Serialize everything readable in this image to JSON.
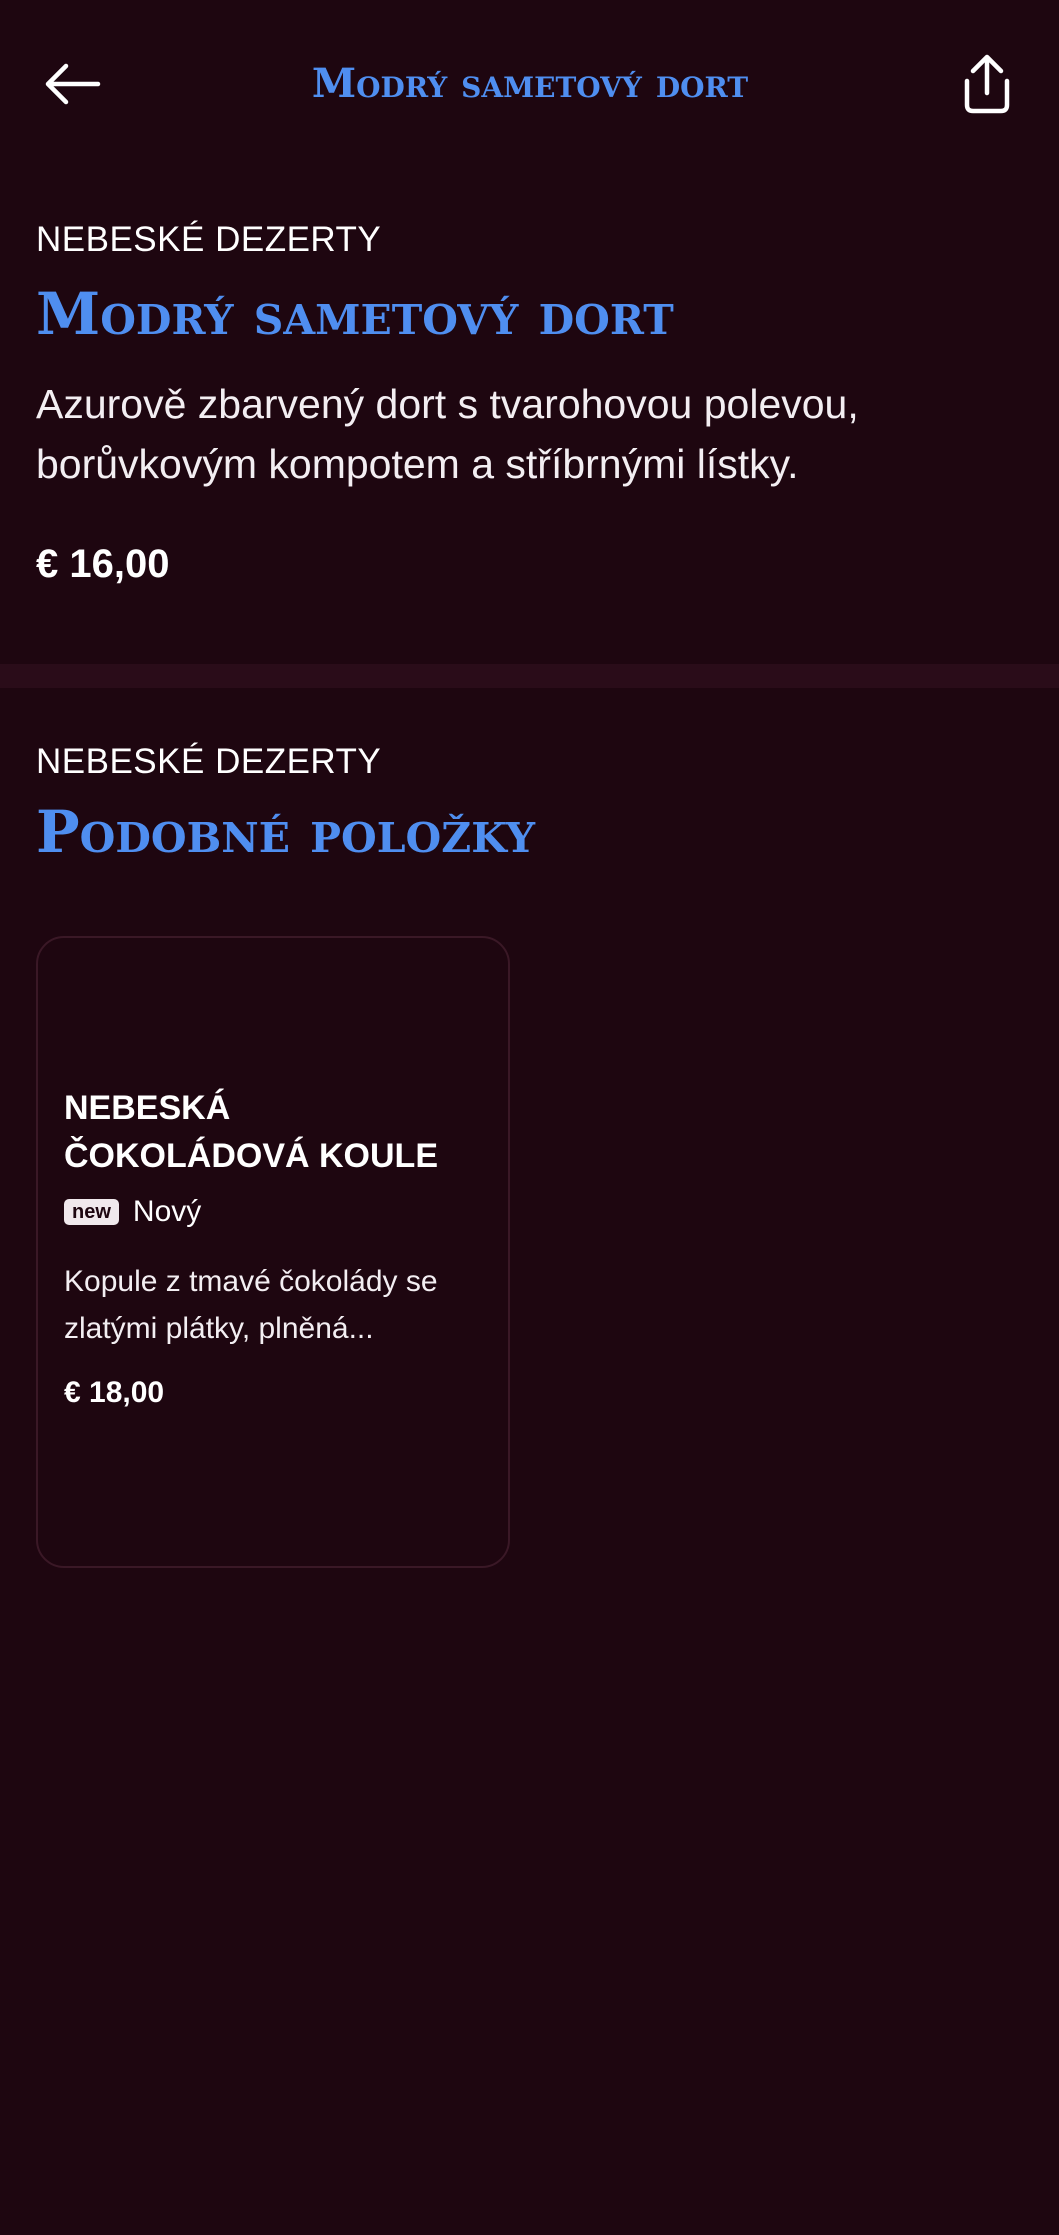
{
  "header": {
    "title": "Modrý sametový dort",
    "back_icon": "arrow-left-icon",
    "share_icon": "share-icon"
  },
  "item": {
    "category": "NEBESKÉ DEZERTY",
    "title": "Modrý sametový dort",
    "description": "Azurově zbarvený dort s tvarohovou polevou, borůvkovým kompotem a stříbrnými lístky.",
    "price": "€ 16,00"
  },
  "similar": {
    "category": "NEBESKÉ DEZERTY",
    "title": "Podobné položky",
    "cards": [
      {
        "title": "NEBESKÁ ČOKOLÁDOVÁ KOULE",
        "badge": "new",
        "badge_label": "Nový",
        "description": "Kopule z tmavé čokolády se zlatými plátky, plněná...",
        "price": "€ 18,00"
      }
    ]
  },
  "colors": {
    "background": "#1e0610",
    "accent": "#4f8ef0",
    "divider": "#2a0c19"
  }
}
